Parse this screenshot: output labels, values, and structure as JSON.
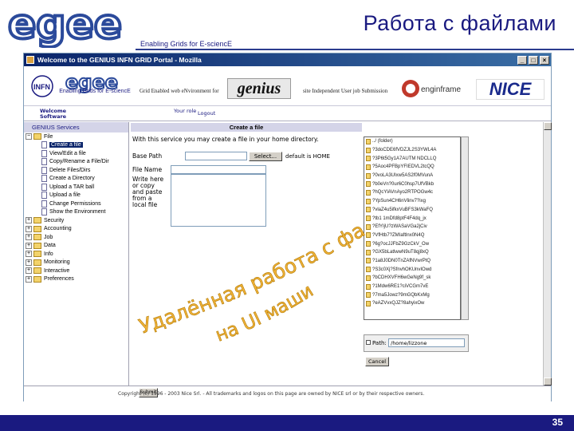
{
  "slide": {
    "title": "Работа с файлами",
    "subtitle": "Enabling Grids for E-sciencE",
    "page_number": "35",
    "logo_text": "egee"
  },
  "browser": {
    "window_title": "Welcome to the GENIUS INFN GRID Portal - Mozilla",
    "banner": {
      "egee_small_text": "Enabling Grids for E-sciencE",
      "text_left": "Grid Enabled web eNvironment for",
      "genius_logo": "genius",
      "text_right": "site Independent User job Submission",
      "enginframe_logo": "enginframe",
      "nice_logo": "NICE"
    },
    "nav": {
      "welcome": "Welcome Software",
      "your_role": "Your role",
      "logout": "Logout"
    },
    "sidebar": {
      "header": "GENIUS Services",
      "items": [
        {
          "label": "File",
          "kind": "folder",
          "expand": "−"
        },
        {
          "label": "Create a file",
          "kind": "file",
          "selected": true
        },
        {
          "label": "View/Edit a file",
          "kind": "file"
        },
        {
          "label": "Copy/Rename a File/Dir",
          "kind": "file"
        },
        {
          "label": "Delete Files/Dirs",
          "kind": "file"
        },
        {
          "label": "Create a Directory",
          "kind": "file"
        },
        {
          "label": "Upload a TAR ball",
          "kind": "file"
        },
        {
          "label": "Upload a file",
          "kind": "file"
        },
        {
          "label": "Change Permissions",
          "kind": "file"
        },
        {
          "label": "Show the Environment",
          "kind": "file"
        },
        {
          "label": "Security",
          "kind": "folder",
          "expand": "+"
        },
        {
          "label": "Accounting",
          "kind": "folder",
          "expand": "+"
        },
        {
          "label": "Job",
          "kind": "folder",
          "expand": "+"
        },
        {
          "label": "Data",
          "kind": "folder",
          "expand": "+"
        },
        {
          "label": "Info",
          "kind": "folder",
          "expand": "+"
        },
        {
          "label": "Monitoring",
          "kind": "folder",
          "expand": "+"
        },
        {
          "label": "Interactive",
          "kind": "folder",
          "expand": "+"
        },
        {
          "label": "Preferences",
          "kind": "folder",
          "expand": "+"
        }
      ]
    },
    "main": {
      "header": "Create a file",
      "intro": "With this service you may create a file in your home directory.",
      "base_path_label": "Base Path",
      "select_button": "Select...",
      "path_note": "default is HOME",
      "filename_label": "File Name",
      "content_label": "Write here or copy and paste from a local file",
      "submit_button": "Submit",
      "copyright": "Copyright (c) 1996 - 2003 Nice Srl. - All trademarks and logos on this page are owned by NICE srl or by their respective owners."
    },
    "chooser": {
      "files": [
        "../ (folder)",
        "?3doCDE6fVDZJL2S3YWL4A",
        "?3P6t5Gy1A7AUTM NDCLLQ",
        "?5Aoc4PFBpYFIEDVL2tcQQ",
        "?0voLA3UIxw5AS2f0MVunA",
        "?b0eVn?0ur6C0hsp7UfVBkb",
        "?hQcYlAVnAyo2RTPOGw4c",
        "?YpSun4CH6nVlinv7?ixg",
        "?vlaZ4u5ifkxVuBFS3kWaFQ",
        "?tb1 1mDfd8ptF4F4dq_jx",
        "?EfYIjU?zWASaVGa2jCiv",
        "?VfHtb7?ZMIaftlnx0N4Q",
        "?6g?ocJJFbZ9GzCkV_Ow",
        "?GX5bLatlwwN9uT8qj8xQ",
        "?1a8J0DN0TnZAfNVwrPtQ",
        "?S3c0Xj?SfnvhOKUnvIOwd",
        "?bCDHXVFH6wGeNg9f_sk",
        "?1Mdw6RE1?ciVCGm7vE",
        "?7ma5Jowz?9mGQbKxMg",
        "?eAZVvxQJZ?8ahyixOw"
      ],
      "path_label": "Path:",
      "path_value": "/home/lizzone",
      "cancel_button": "Cancel"
    }
  },
  "annotation": {
    "line1": "Удалённая работа с файлами",
    "line2": "на UI машине",
    "color": "#f2b43a"
  },
  "colors": {
    "brand_navy": "#1a1a80",
    "egee_blue": "#2b4a9b",
    "titlebar": "#0a246a"
  }
}
